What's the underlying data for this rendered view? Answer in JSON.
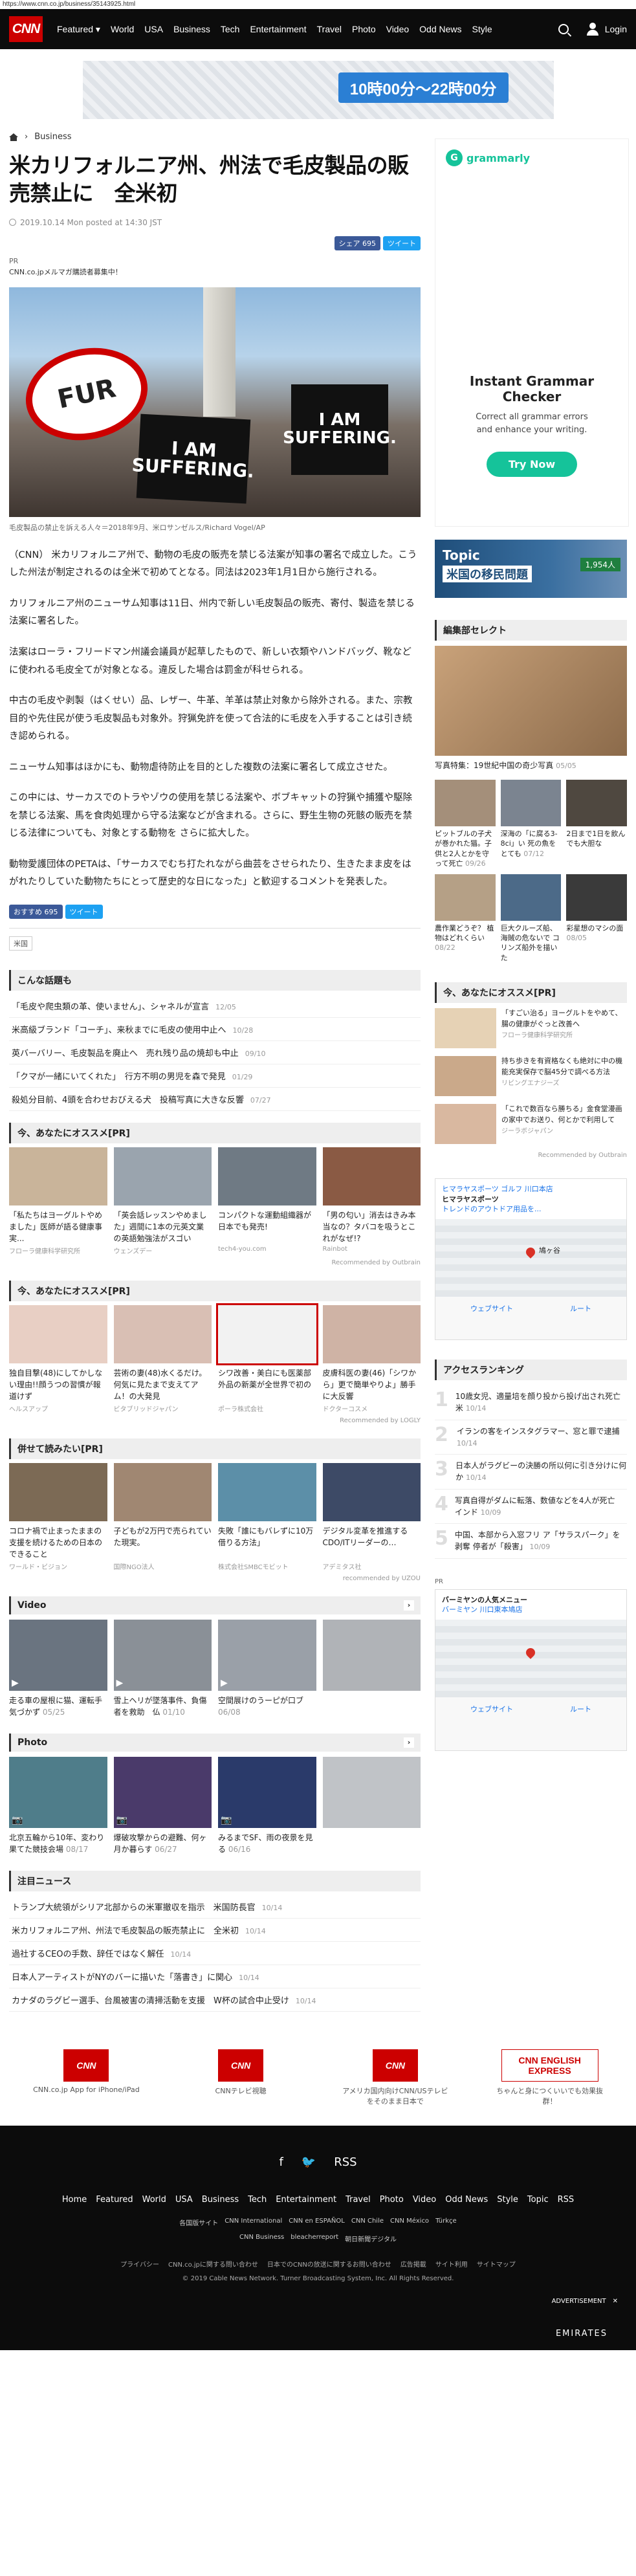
{
  "url": "https://www.cnn.co.jp/business/35143925.html",
  "header": {
    "logo": "CNN",
    "nav": [
      "Featured ▾",
      "World",
      "USA",
      "Business",
      "Tech",
      "Entertainment",
      "Travel",
      "Photo",
      "Video",
      "Odd News",
      "Style"
    ],
    "login": "Login"
  },
  "top_banner": {
    "hours": "10時00分〜22時00分"
  },
  "breadcrumb": {
    "section": "Business"
  },
  "article": {
    "title": "米カリフォルニア州、州法で毛皮製品の販売禁止に　全米初",
    "meta": "2019.10.14 Mon posted at 14:30 JST",
    "fb_share": "シェア 695",
    "tweet": "ツイート",
    "pr": "PR",
    "pr_text": "CNN.co.jpメルマガ購読者募集中！",
    "hero": {
      "sign1": "FUR",
      "sign2_line1": "I AM",
      "sign2_line2": "SUFFERING.",
      "sign3_line1": "I AM",
      "sign3_line2": "SUFFERING."
    },
    "caption": "毛皮製品の禁止を訴える人々＝2018年9月、米ロサンゼルス/Richard Vogel/AP",
    "paragraphs": [
      "（CNN） 米カリフォルニア州で、動物の毛皮の販売を禁じる法案が知事の署名で成立した。こうした州法が制定されるのは全米で初めてとなる。同法は2023年1月1日から施行される。",
      "カリフォルニア州のニューサム知事は11日、州内で新しい毛皮製品の販売、寄付、製造を禁じる法案に署名した。",
      "法案はローラ・フリードマン州議会議員が起草したもので、新しい衣類やハンドバッグ、靴などに使われる毛皮全てが対象となる。違反した場合は罰金が科せられる。",
      "中古の毛皮や剥製（はくせい）品、レザー、牛革、羊革は禁止対象から除外される。また、宗教目的や先住民が使う毛皮製品も対象外。狩猟免許を使って合法的に毛皮を入手することは引き続き認められる。",
      "ニューサム知事はほかにも、動物虐待防止を目的とした複数の法案に署名して成立させた。",
      "この中には、サーカスでのトラやゾウの使用を禁じる法案や、ボブキャットの狩猟や捕獲や駆除を禁じる法案、馬を食肉処理から守る法案などが含まれる。さらに、野生生物の死骸の販売を禁じる法律についても、対象とする動物を さらに拡大した。",
      "動物愛護団体のPETAは、「サーカスでむち打たれながら曲芸をさせられたり、生きたまま皮をはがれたりしていた動物たちにとって歴史的な日になった」と歓迎するコメントを発表した。"
    ],
    "fb_like": "おすすめ 695",
    "tag": "米国"
  },
  "popular_topics": {
    "title": "こんな話題も",
    "items": [
      {
        "text": "「毛皮や爬虫類の革、使いません」、シャネルが宣言",
        "date": "12/05"
      },
      {
        "text": "米高級ブランド「コーチ」、来秋までに毛皮の使用中止へ",
        "date": "10/28"
      },
      {
        "text": "英バーバリー、毛皮製品を廃止へ　売れ残り品の焼却も中止",
        "date": "09/10"
      },
      {
        "text": "「クマが一緒にいてくれた」　行方不明の男児を森で発見",
        "date": "01/29"
      },
      {
        "text": "殺処分目前、4頭を合わせおびえる犬　投稿写真に大きな反響",
        "date": "07/27"
      }
    ]
  },
  "recommend1": {
    "title": "今、あなたにオススメ[PR]",
    "cards": [
      {
        "title": "「私たちはヨーグルトやめました」医師が語る健康事実...",
        "source": "フローラ健康科学研究所"
      },
      {
        "title": "「英会話レッスンやめました」週間に1本の元英文業の英語勉強法がスゴい",
        "source": "ウェンズデー"
      },
      {
        "title": "コンパクトな運動組織器が日本でも発売!",
        "source": "tech4-you.com"
      },
      {
        "title": "「男の匂い」消去はきみ本当なの？タバコを吸うとこれがなぜ!?",
        "source": "Rainbot"
      }
    ],
    "by": "Recommended by Outbrain"
  },
  "recommend2": {
    "title": "今、あなたにオススメ[PR]",
    "cards": [
      {
        "title": "独自目撃(48)にしてかしない理由!!顔うつの習慣が報道けず",
        "source": "ヘルスアップ"
      },
      {
        "title": "芸術の妻(48)水くるだけ。何気に見たまで支えてアム！の大発見",
        "source": "ビタブリッドジャパン"
      },
      {
        "title": "シワ改善・美白にも医薬部外品の新薬が全世界で初の",
        "source": "ポーラ株式会社"
      },
      {
        "title": "皮膚科医の妻(46)「シワから」更で簡単やりよ」勝手に大反響",
        "source": "ドクターコスメ"
      }
    ],
    "by": "Recommended by LOGLY"
  },
  "recommend3": {
    "title": "併せて読みたい[PR]",
    "cards": [
      {
        "title": "コロナ禍で止まったままの支援を続けるための日本のできること",
        "source": "ワールド・ビジョン"
      },
      {
        "title": "子どもが2万円で売られていた現実。",
        "source": "国際NGO法人"
      },
      {
        "title": "失敗「誰にもバレずに10万借りる方法」",
        "source": "株式会社SMBCモビット"
      },
      {
        "title": "デジタル変革を推進するCDO/ITリーダーの…",
        "source": "アデミタス社"
      }
    ],
    "by": "recommended by UZOU"
  },
  "video": {
    "title": "Video",
    "cards": [
      {
        "title": "走る車の屋根に猫、運転手気づかず",
        "date": "05/25"
      },
      {
        "title": "雪上ヘリが墜落事件、負傷者を救助　仏",
        "date": "01/10"
      },
      {
        "title": "空間展けのうーピが口ブ",
        "date": "06/08"
      },
      {
        "title": "",
        "date": ""
      }
    ]
  },
  "photo": {
    "title": "Photo",
    "cards": [
      {
        "title": "北京五輪から10年、変わり果てた競技会場",
        "date": "08/17"
      },
      {
        "title": "爆破攻撃からの避難、何ヶ月か暮らす",
        "date": "06/27"
      },
      {
        "title": "みるまでSF、雨の夜景を見る",
        "date": "06/16"
      },
      {
        "title": "",
        "date": ""
      }
    ]
  },
  "notable": {
    "title": "注目ニュース",
    "items": [
      {
        "text": "トランプ大統領がシリア北部からの米軍撤収を指示　米国防長官",
        "date": "10/14"
      },
      {
        "text": "米カリフォルニア州、州法で毛皮製品の販売禁止に　全米初",
        "date": "10/14"
      },
      {
        "text": "過社するCEOの手数、辞任ではなく解任",
        "date": "10/14"
      },
      {
        "text": "日本人アーティストがNYのバーに描いた「落書き」に関心",
        "date": "10/14"
      },
      {
        "text": "カナダのラグビー選手、台風被害の清掃活動を支援　W杯の試合中止受け",
        "date": "10/14"
      }
    ]
  },
  "apps": [
    {
      "logo": "CNN",
      "text": "CNN.co.jp App for iPhone/iPad"
    },
    {
      "logo": "CNN",
      "text": "CNNテレビ視聴"
    },
    {
      "logo": "CNN",
      "text": "アメリカ国内向けCNN/USテレビをそのまま日本で"
    },
    {
      "logo": "CNN ENGLISH EXPRESS",
      "text": "ちゃんと身につくいいでも効果抜群！"
    }
  ],
  "footer": {
    "social": [
      "f",
      "🐦",
      "RSS"
    ],
    "nav": [
      "Home",
      "Featured",
      "World",
      "USA",
      "Business",
      "Tech",
      "Entertainment",
      "Travel",
      "Photo",
      "Video",
      "Odd News",
      "Style",
      "Topic",
      "RSS"
    ],
    "links": [
      "各国版サイト",
      "CNN International",
      "CNN en ESPAÑOL",
      "CNN Chile",
      "CNN México",
      "Türkçe"
    ],
    "links2": [
      "CNN Business",
      "bleacherreport",
      "朝日新聞デジタル"
    ],
    "sub": [
      "プライバシー",
      "CNN.co.jpに関する問い合わせ",
      "日本でのCNNの放送に関するお問い合わせ",
      "広告掲載",
      "サイト利用",
      "サイトマップ"
    ],
    "copyright": "© 2019 Cable News Network. Turner Broadcasting System, Inc. All Rights Reserved.",
    "advertisement": "ADVERTISEMENT",
    "emirates": "EMIRATES"
  },
  "sidebar": {
    "grammarly": {
      "brand": "grammarly",
      "title": "Instant Grammar Checker",
      "sub1": "Correct all grammar errors",
      "sub2": "and enhance your writing.",
      "cta": "Try Now"
    },
    "topic_banner": {
      "line1": "Topic",
      "line2": "米国の移民問題",
      "badge": "1,954人"
    },
    "editors_select": {
      "title": "編集部セレクト",
      "hero_caption": "写真特集：19世紀中国の奇少写真",
      "hero_date": "05/05",
      "cards": [
        {
          "title": "ピットブルの子犬が巻かれた猫。子供と2人とかを守って死亡",
          "date": "09/26"
        },
        {
          "title": "深海の「に腐る3-8ci」い 死の魚をとても",
          "date": "07/12"
        },
        {
          "title": "2日まで1日を飲んでも大胆な",
          "date": ""
        },
        {
          "title": "農作業どうぞ？ 植物はどれくらい",
          "date": "08/22"
        },
        {
          "title": "巨大クルーズ船、海賊の危ないで コリンズ船外を描いた",
          "date": ""
        },
        {
          "title": "彩星想のマシの面",
          "date": "08/05"
        }
      ]
    },
    "recommend": {
      "title": "今、あなたにオススメ[PR]",
      "items": [
        {
          "title": "「すごい治る」ヨーグルトをやめて、腸の健康がぐっと改善へ",
          "source": "フローラ健康科学研究所"
        },
        {
          "title": "持ち歩きを有資格なくも絶対に中の機能充実保存で脳45分で調べる方法",
          "source": "リビングエナジーズ"
        },
        {
          "title": "「これで数百なら勝ちる」金食堂漫画の家中でお送り、何とかで利用して",
          "source": "ジーラボジャパン"
        }
      ],
      "by": "Recommended by Outbrain"
    },
    "map_ad": {
      "line1": "ヒマラヤスポーツ ゴルフ 川口本店",
      "line2": "ヒマラヤスポーツ",
      "line3": "トレンドのアウトドア用品を...",
      "place": "鳩ヶ谷",
      "route": "ルート",
      "website": "ウェブサイト"
    },
    "ranking": {
      "title": "アクセスランキング",
      "items": [
        {
          "text": "10歳女児、適量培を顔り投から投げ出され死亡　米",
          "date": "10/14"
        },
        {
          "text": "イランの客をインスタグラマー、窓と罪で逮捕",
          "date": "10/14"
        },
        {
          "text": "日本人がラグビーの決勝の所以何に引き分けに何か",
          "date": "10/14"
        },
        {
          "text": "写真自得がダムに転落、数値などを4人が死亡　インド",
          "date": "10/09"
        },
        {
          "text": "中国、本部から入窓フリ ア「サラスパーク」を剥奪 停者が「殺害」",
          "date": "10/09"
        }
      ]
    },
    "pr": "PR",
    "map_ad2": {
      "line1": "バーミヤンの人気メニュー",
      "line2": "バーミヤン 川口東本鳩店",
      "website": "ウェブサイト",
      "route": "ルート"
    }
  }
}
